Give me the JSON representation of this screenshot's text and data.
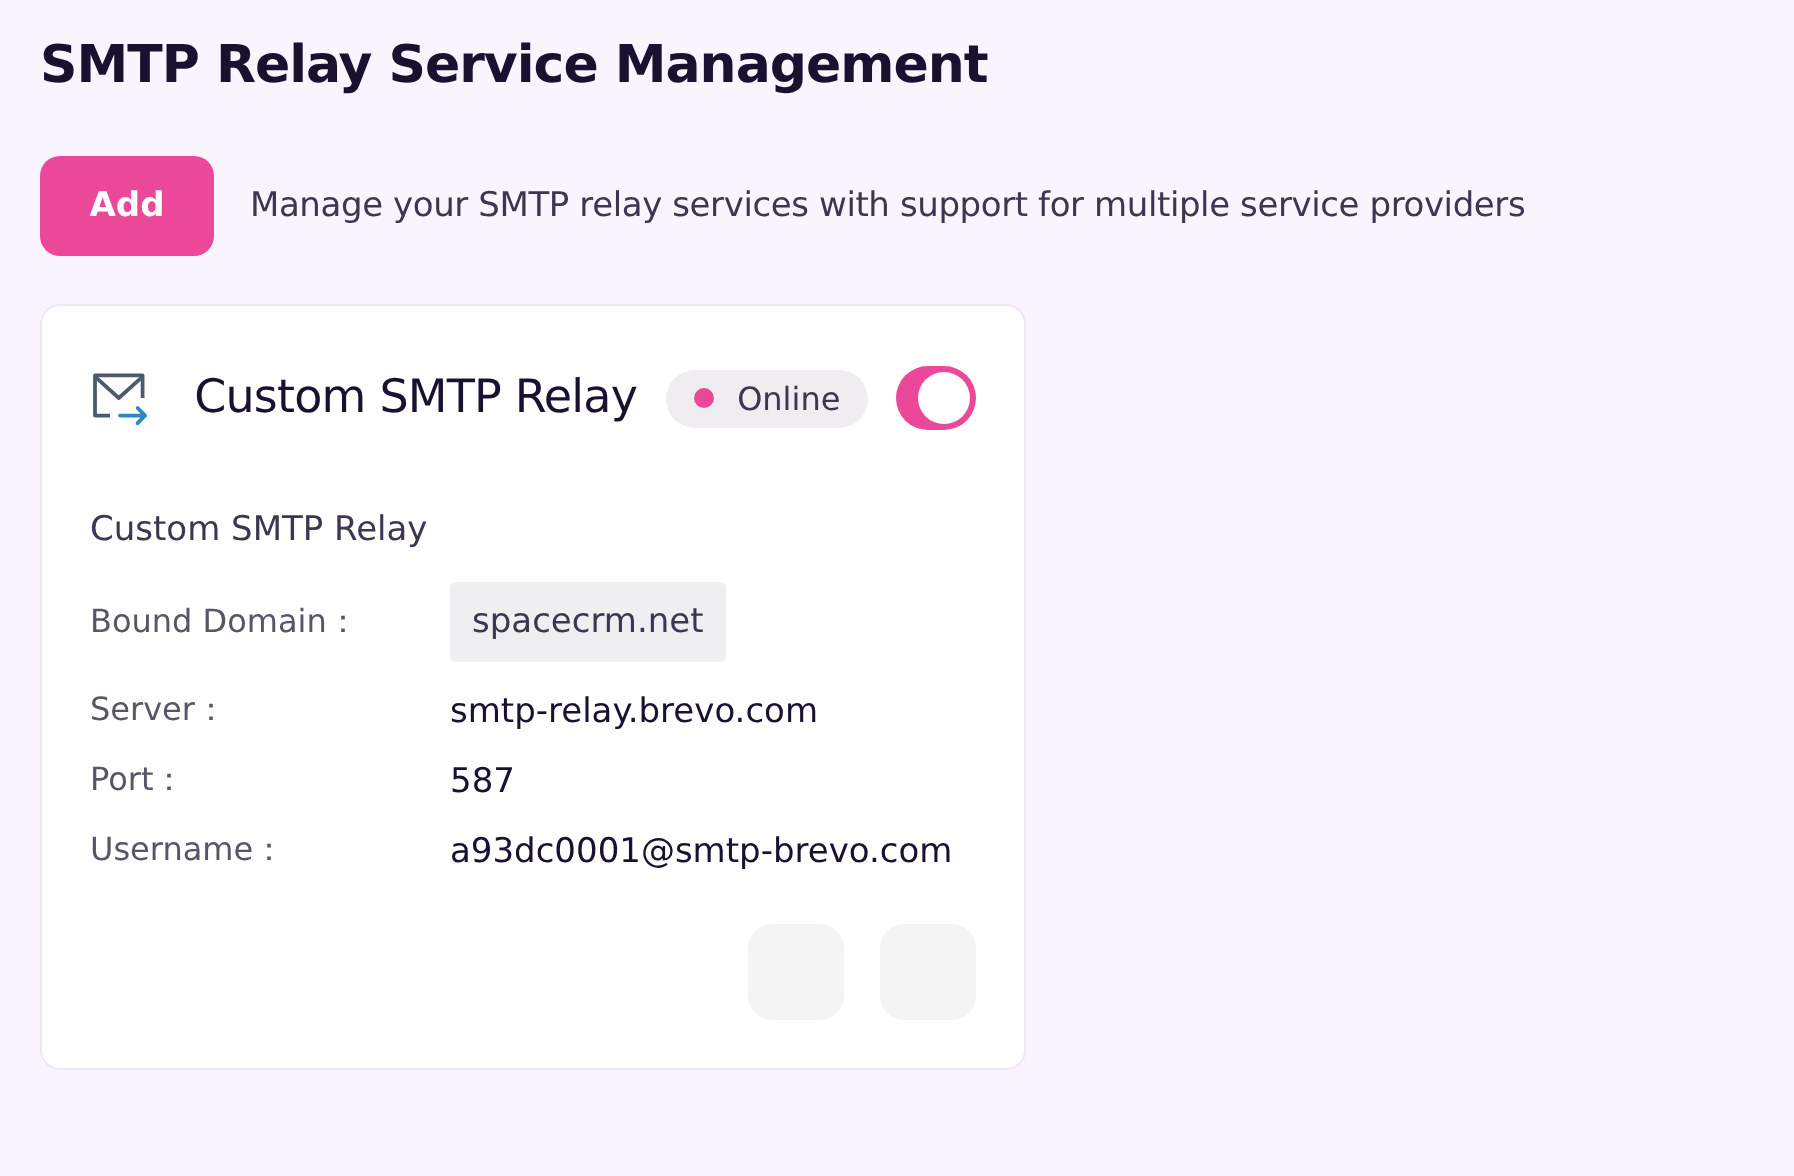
{
  "page": {
    "title": "SMTP Relay Service Management"
  },
  "toolbar": {
    "add_button": "Add",
    "description": "Manage your SMTP relay services with support for multiple service providers"
  },
  "relays": [
    {
      "name": "Custom SMTP Relay",
      "status": {
        "label": "Online",
        "color": "#ec4899"
      },
      "enabled": true,
      "subtitle": "Custom SMTP Relay",
      "fields": [
        {
          "label": "Bound Domain：",
          "value": "spacecrm.net",
          "kind": "tag"
        },
        {
          "label": "Server：",
          "value": "smtp-relay.brevo.com",
          "kind": "text"
        },
        {
          "label": "Port：",
          "value": "587",
          "kind": "text"
        },
        {
          "label": "Username：",
          "value": "a93dc0001@smtp-brevo.com",
          "kind": "text"
        }
      ],
      "actions": [
        {
          "kind": "button"
        },
        {
          "kind": "button"
        }
      ]
    }
  ]
}
